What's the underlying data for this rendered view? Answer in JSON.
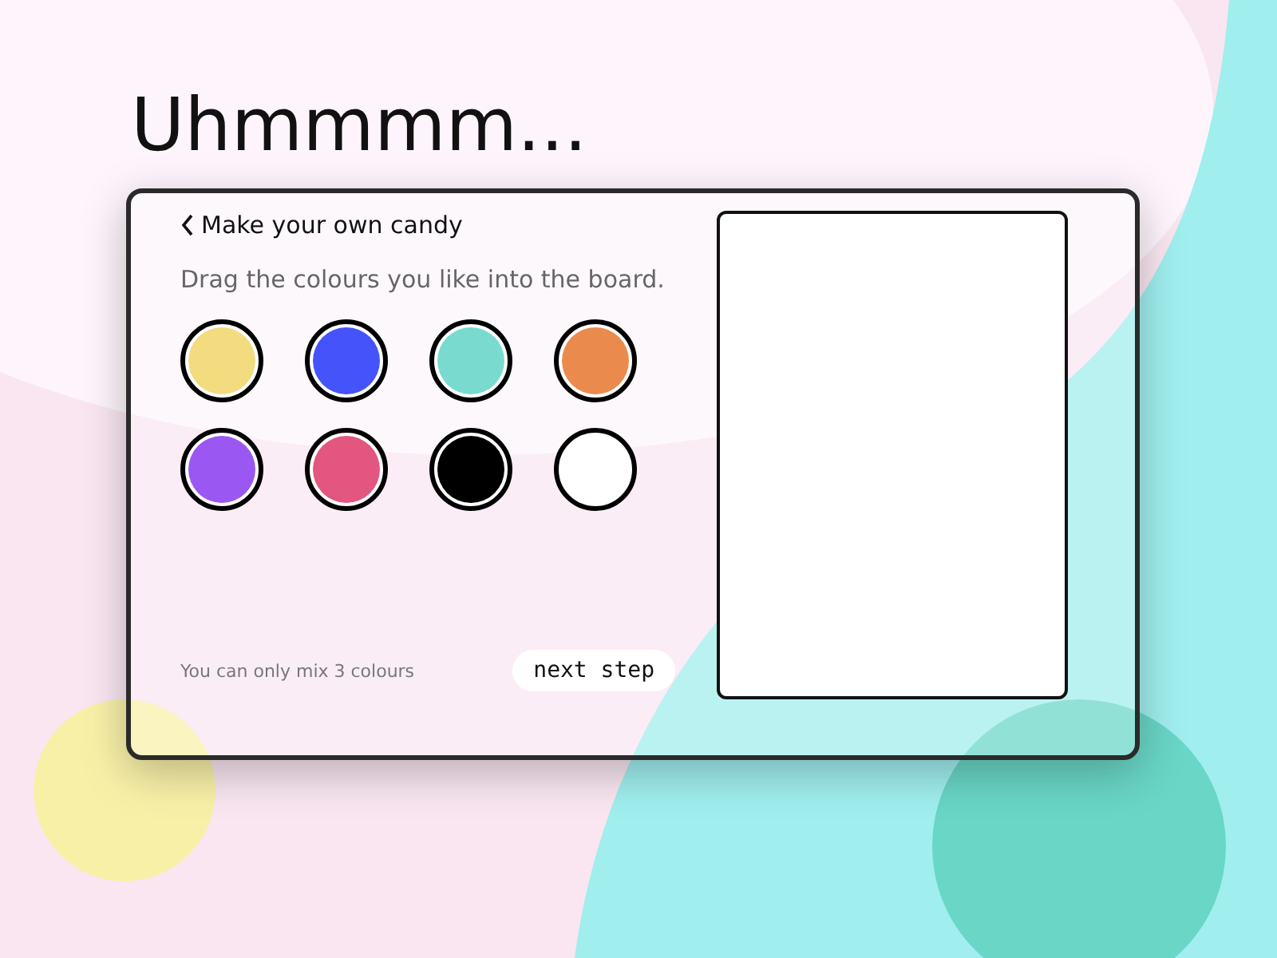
{
  "heading": "Uhmmmm...",
  "panel": {
    "back_title": "Make your own candy",
    "instruction": "Drag the colours you like into the board.",
    "swatches": [
      {
        "color": "#f2dc7f"
      },
      {
        "color": "#4553fb"
      },
      {
        "color": "#79dbcf"
      },
      {
        "color": "#eb8a4d"
      },
      {
        "color": "#9b57f2"
      },
      {
        "color": "#e3567f"
      },
      {
        "color": "#000000"
      },
      {
        "color": "#ffffff"
      }
    ],
    "hint": "You can only mix 3 colours",
    "next_button": "next step"
  }
}
